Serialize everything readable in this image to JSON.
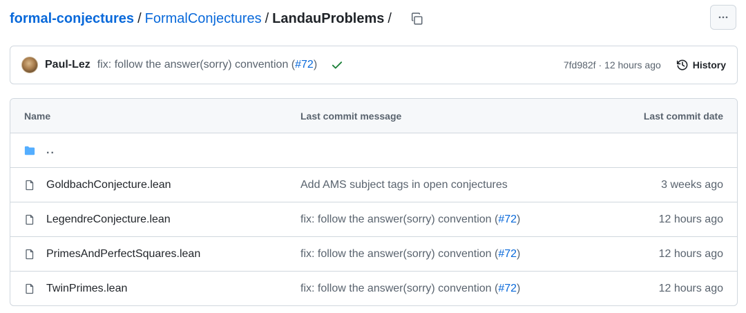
{
  "breadcrumb": {
    "repo": "formal-conjectures",
    "folder": "FormalConjectures",
    "current": "LandauProblems",
    "separator": "/",
    "trailing_separator": "/"
  },
  "icons": {
    "copy": "copy-icon",
    "more": "kebab-horizontal-icon",
    "check": "check-icon",
    "history": "history-icon",
    "folder": "folder-icon",
    "file": "file-icon"
  },
  "colors": {
    "link": "#0969da",
    "check": "#1a7f37",
    "folder": "#54aeff",
    "muted": "#59636e",
    "border": "#d0d7de"
  },
  "latest_commit": {
    "author": "Paul-Lez",
    "message_prefix": "fix: follow the answer(sorry) convention (",
    "pr_link": "#72",
    "message_suffix": ")",
    "hash": "7fd982f",
    "separator": " · ",
    "time": "12 hours ago",
    "history_label": "History"
  },
  "table": {
    "headers": {
      "name": "Name",
      "message": "Last commit message",
      "date": "Last commit date"
    },
    "parent_dir": "..",
    "rows": [
      {
        "name": "GoldbachConjecture.lean",
        "message": "Add AMS subject tags in open conjectures",
        "pr": "",
        "suffix": "",
        "date": "3 weeks ago"
      },
      {
        "name": "LegendreConjecture.lean",
        "message": "fix: follow the answer(sorry) convention (",
        "pr": "#72",
        "suffix": ")",
        "date": "12 hours ago"
      },
      {
        "name": "PrimesAndPerfectSquares.lean",
        "message": "fix: follow the answer(sorry) convention (",
        "pr": "#72",
        "suffix": ")",
        "date": "12 hours ago"
      },
      {
        "name": "TwinPrimes.lean",
        "message": "fix: follow the answer(sorry) convention (",
        "pr": "#72",
        "suffix": ")",
        "date": "12 hours ago"
      }
    ]
  }
}
